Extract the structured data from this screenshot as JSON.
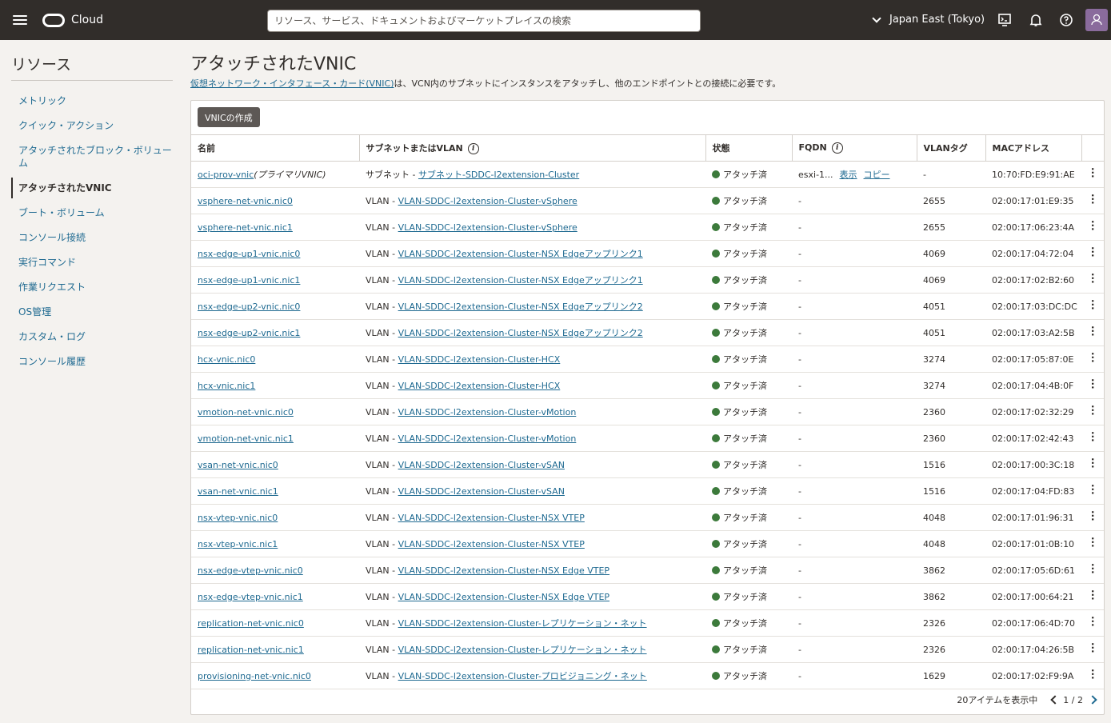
{
  "topbar": {
    "brand": "Cloud",
    "search_placeholder": "リソース、サービス、ドキュメントおよびマーケットプレイスの検索",
    "region": "Japan East (Tokyo)",
    "icons": [
      "hamburger-menu-icon",
      "oracle-logo",
      "cloud-shell-icon",
      "notification-bell-icon",
      "help-icon",
      "profile-avatar"
    ]
  },
  "sidebar": {
    "title": "リソース",
    "items": [
      {
        "label": "メトリック",
        "active": false
      },
      {
        "label": "クイック・アクション",
        "active": false
      },
      {
        "label": "アタッチされたブロック・ボリューム",
        "active": false
      },
      {
        "label": "アタッチされたVNIC",
        "active": true
      },
      {
        "label": "ブート・ボリューム",
        "active": false
      },
      {
        "label": "コンソール接続",
        "active": false
      },
      {
        "label": "実行コマンド",
        "active": false
      },
      {
        "label": "作業リクエスト",
        "active": false
      },
      {
        "label": "OS管理",
        "active": false
      },
      {
        "label": "カスタム・ログ",
        "active": false
      },
      {
        "label": "コンソール履歴",
        "active": false
      }
    ]
  },
  "main": {
    "title": "アタッチされたVNIC",
    "desc_link": "仮想ネットワーク・インタフェース・カード(VNIC)",
    "desc_rest": "は、VCN内のサブネットにインスタンスをアタッチし、他のエンドポイントとの接続に必要です。",
    "create_button": "VNICの作成",
    "columns": [
      "名前",
      "サブネットまたはVLAN",
      "状態",
      "FQDN",
      "VLANタグ",
      "MACアドレス"
    ],
    "status_color": "#3c7a3b",
    "rows": [
      {
        "name": "oci-prov-vnic",
        "name_suffix": "(プライマリVNIC)",
        "net_type": "サブネット - ",
        "net": "サブネット-SDDC-l2extension-Cluster",
        "state": "アタッチ済",
        "fqdn": "esxi-1...",
        "fqdn_show": "表示",
        "fqdn_copy": "コピー",
        "vlan": "-",
        "mac": "10:70:FD:E9:91:AE"
      },
      {
        "name": "vsphere-net-vnic.nic0",
        "net_type": "VLAN - ",
        "net": "VLAN-SDDC-l2extension-Cluster-vSphere",
        "state": "アタッチ済",
        "fqdn": "-",
        "vlan": "2655",
        "mac": "02:00:17:01:E9:35"
      },
      {
        "name": "vsphere-net-vnic.nic1",
        "net_type": "VLAN - ",
        "net": "VLAN-SDDC-l2extension-Cluster-vSphere",
        "state": "アタッチ済",
        "fqdn": "-",
        "vlan": "2655",
        "mac": "02:00:17:06:23:4A"
      },
      {
        "name": "nsx-edge-up1-vnic.nic0",
        "net_type": "VLAN - ",
        "net": "VLAN-SDDC-l2extension-Cluster-NSX Edgeアップリンク1",
        "state": "アタッチ済",
        "fqdn": "-",
        "vlan": "4069",
        "mac": "02:00:17:04:72:04"
      },
      {
        "name": "nsx-edge-up1-vnic.nic1",
        "net_type": "VLAN - ",
        "net": "VLAN-SDDC-l2extension-Cluster-NSX Edgeアップリンク1",
        "state": "アタッチ済",
        "fqdn": "-",
        "vlan": "4069",
        "mac": "02:00:17:02:B2:60"
      },
      {
        "name": "nsx-edge-up2-vnic.nic0",
        "net_type": "VLAN - ",
        "net": "VLAN-SDDC-l2extension-Cluster-NSX Edgeアップリンク2",
        "state": "アタッチ済",
        "fqdn": "-",
        "vlan": "4051",
        "mac": "02:00:17:03:DC:DC"
      },
      {
        "name": "nsx-edge-up2-vnic.nic1",
        "net_type": "VLAN - ",
        "net": "VLAN-SDDC-l2extension-Cluster-NSX Edgeアップリンク2",
        "state": "アタッチ済",
        "fqdn": "-",
        "vlan": "4051",
        "mac": "02:00:17:03:A2:5B"
      },
      {
        "name": "hcx-vnic.nic0",
        "net_type": "VLAN - ",
        "net": "VLAN-SDDC-l2extension-Cluster-HCX",
        "state": "アタッチ済",
        "fqdn": "-",
        "vlan": "3274",
        "mac": "02:00:17:05:87:0E"
      },
      {
        "name": "hcx-vnic.nic1",
        "net_type": "VLAN - ",
        "net": "VLAN-SDDC-l2extension-Cluster-HCX",
        "state": "アタッチ済",
        "fqdn": "-",
        "vlan": "3274",
        "mac": "02:00:17:04:4B:0F"
      },
      {
        "name": "vmotion-net-vnic.nic0",
        "net_type": "VLAN - ",
        "net": "VLAN-SDDC-l2extension-Cluster-vMotion",
        "state": "アタッチ済",
        "fqdn": "-",
        "vlan": "2360",
        "mac": "02:00:17:02:32:29"
      },
      {
        "name": "vmotion-net-vnic.nic1",
        "net_type": "VLAN - ",
        "net": "VLAN-SDDC-l2extension-Cluster-vMotion",
        "state": "アタッチ済",
        "fqdn": "-",
        "vlan": "2360",
        "mac": "02:00:17:02:42:43"
      },
      {
        "name": "vsan-net-vnic.nic0",
        "net_type": "VLAN - ",
        "net": "VLAN-SDDC-l2extension-Cluster-vSAN",
        "state": "アタッチ済",
        "fqdn": "-",
        "vlan": "1516",
        "mac": "02:00:17:00:3C:18"
      },
      {
        "name": "vsan-net-vnic.nic1",
        "net_type": "VLAN - ",
        "net": "VLAN-SDDC-l2extension-Cluster-vSAN",
        "state": "アタッチ済",
        "fqdn": "-",
        "vlan": "1516",
        "mac": "02:00:17:04:FD:83"
      },
      {
        "name": "nsx-vtep-vnic.nic0",
        "net_type": "VLAN - ",
        "net": "VLAN-SDDC-l2extension-Cluster-NSX VTEP",
        "state": "アタッチ済",
        "fqdn": "-",
        "vlan": "4048",
        "mac": "02:00:17:01:96:31"
      },
      {
        "name": "nsx-vtep-vnic.nic1",
        "net_type": "VLAN - ",
        "net": "VLAN-SDDC-l2extension-Cluster-NSX VTEP",
        "state": "アタッチ済",
        "fqdn": "-",
        "vlan": "4048",
        "mac": "02:00:17:01:0B:10"
      },
      {
        "name": "nsx-edge-vtep-vnic.nic0",
        "net_type": "VLAN - ",
        "net": "VLAN-SDDC-l2extension-Cluster-NSX Edge VTEP",
        "state": "アタッチ済",
        "fqdn": "-",
        "vlan": "3862",
        "mac": "02:00:17:05:6D:61"
      },
      {
        "name": "nsx-edge-vtep-vnic.nic1",
        "net_type": "VLAN - ",
        "net": "VLAN-SDDC-l2extension-Cluster-NSX Edge VTEP",
        "state": "アタッチ済",
        "fqdn": "-",
        "vlan": "3862",
        "mac": "02:00:17:00:64:21"
      },
      {
        "name": "replication-net-vnic.nic0",
        "net_type": "VLAN - ",
        "net": "VLAN-SDDC-l2extension-Cluster-レプリケーション・ネット",
        "state": "アタッチ済",
        "fqdn": "-",
        "vlan": "2326",
        "mac": "02:00:17:06:4D:70"
      },
      {
        "name": "replication-net-vnic.nic1",
        "net_type": "VLAN - ",
        "net": "VLAN-SDDC-l2extension-Cluster-レプリケーション・ネット",
        "state": "アタッチ済",
        "fqdn": "-",
        "vlan": "2326",
        "mac": "02:00:17:04:26:5B"
      },
      {
        "name": "provisioning-net-vnic.nic0",
        "net_type": "VLAN - ",
        "net": "VLAN-SDDC-l2extension-Cluster-プロビジョニング・ネット",
        "state": "アタッチ済",
        "fqdn": "-",
        "vlan": "1629",
        "mac": "02:00:17:02:F9:9A"
      }
    ],
    "footer_count": "20アイテムを表示中",
    "page": "1 / 2"
  }
}
